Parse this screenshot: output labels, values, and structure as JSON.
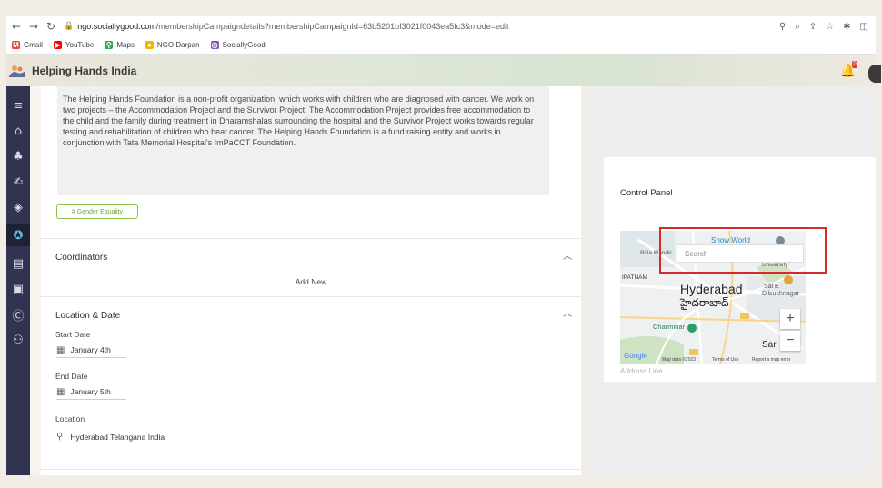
{
  "browser": {
    "url_host": "ngo.sociallygood.com",
    "url_rest": "/membershipCampaigndetails?membershipCampaignId=63b5201bf3021f0043ea5fc3&mode=edit",
    "bookmarks": [
      {
        "label": "Gmail",
        "color": "#ea4335",
        "glyph": "M"
      },
      {
        "label": "YouTube",
        "color": "#ff0000",
        "glyph": "▶"
      },
      {
        "label": "Maps",
        "color": "#34a853",
        "glyph": "⚲"
      },
      {
        "label": "NGO Darpan",
        "color": "#f4b400",
        "glyph": "●"
      },
      {
        "label": "SociallyGood",
        "color": "#7e57c2",
        "glyph": "◎"
      }
    ]
  },
  "app": {
    "title": "Helping Hands India",
    "notification_count": "0"
  },
  "main": {
    "description": "The Helping Hands Foundation is a non-profit organization, which works with children who are diagnosed with cancer. We work on two projects – the Accommodation Project and the Survivor Project. The Accommodation Project provides free accommodation to the child and the family during treatment in Dharamshalas surrounding the hospital and the Survivor Project works towards regular testing and rehabilitation of children who beat cancer. The Helping Hands Foundation is a fund raising entity and works in conjunction with Tata Memorial Hospital's ImPaCCT Foundation.",
    "tag": "# Gender Equality",
    "coordinators_title": "Coordinators",
    "add_new": "Add New",
    "location_title": "Location & Date",
    "start_date_label": "Start Date",
    "start_date_value": "January 4th",
    "end_date_label": "End Date",
    "end_date_value": "January 5th",
    "location_label": "Location",
    "location_value": "Hyderabad Telangana India"
  },
  "control_panel": {
    "title": "Control Panel",
    "map_search_placeholder": "Search",
    "address_line_placeholder": "Address Line",
    "map_labels": {
      "snow_world": "Snow World",
      "birla": "Birla Mandir",
      "university": "University",
      "patnam": "IPATNAM",
      "hyderabad": "Hyderabad",
      "hyderabad_te": "హైదరాబాద్",
      "charminar": "Charminar",
      "sai_e": "Sai E",
      "dilsukhnagar": "Dilsukhnagar",
      "saroor": "Sar",
      "map_data": "Map data ©2023",
      "terms": "Terms of Use",
      "report": "Report a map error",
      "google": "Google"
    }
  }
}
